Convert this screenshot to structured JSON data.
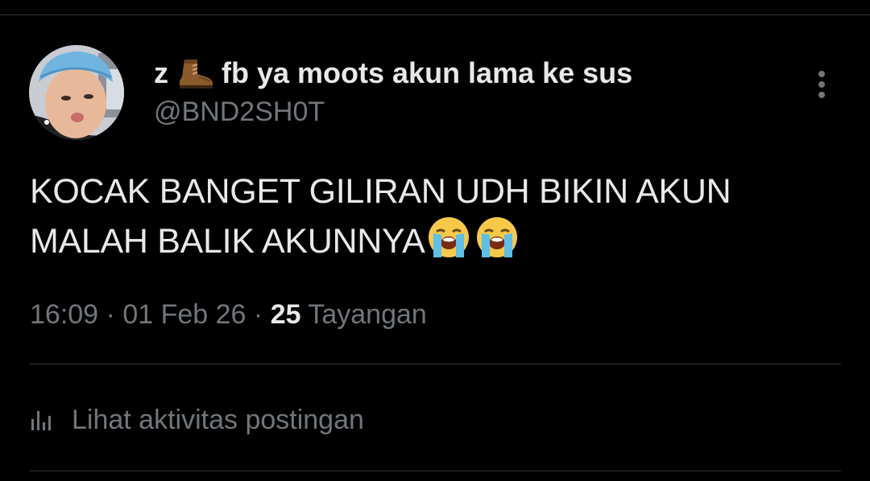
{
  "author": {
    "name_prefix": "z",
    "name_icon": "boot-emoji-icon",
    "name_suffix": "fb ya moots akun lama ke sus",
    "handle": "@BND2SH0T",
    "avatar_icon": "profile-avatar"
  },
  "more_icon": "more-options-icon",
  "tweet": {
    "line1": "KOCAK BANGET GILIRAN UDH BIKIN AKUN",
    "line2": "MALAH BALIK AKUNNYA",
    "emojis": [
      "loudly-crying-face-icon",
      "loudly-crying-face-icon"
    ]
  },
  "meta": {
    "time": "16:09",
    "separator1": "·",
    "date": "01 Feb 26",
    "separator2": "·",
    "views_count": "25",
    "views_label": "Tayangan"
  },
  "activity": {
    "icon": "stats-bar-icon",
    "label": "Lihat aktivitas postingan"
  },
  "colors": {
    "background": "#000000",
    "primary_text": "#e7e9ea",
    "secondary_text": "#71767b",
    "divider": "#2f3336"
  }
}
